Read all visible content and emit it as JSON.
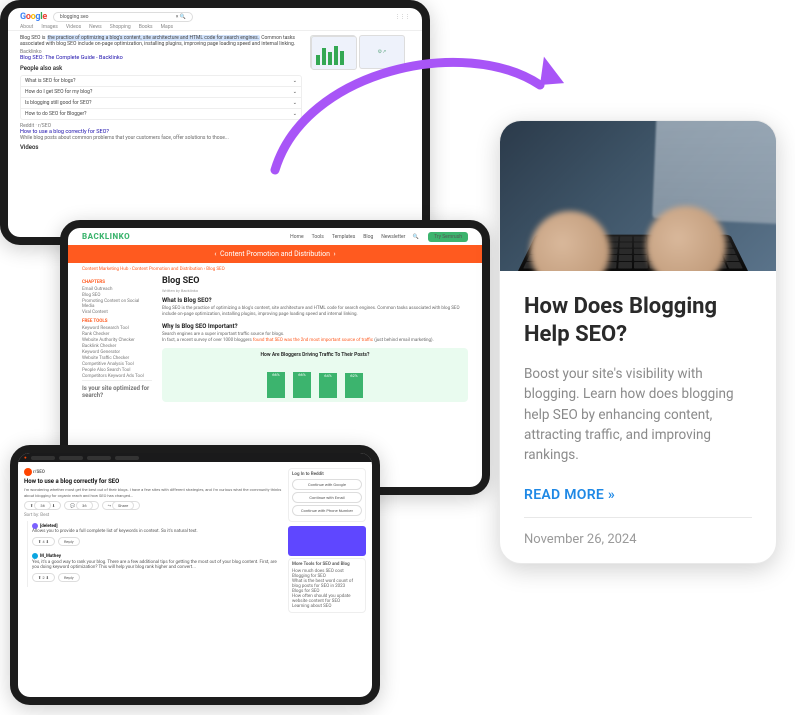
{
  "google": {
    "logo": [
      "G",
      "o",
      "o",
      "g",
      "l",
      "e"
    ],
    "query": "blogging seo",
    "tabs": [
      "About",
      "Images",
      "Videos",
      "News",
      "Shopping",
      "Books",
      "Maps"
    ],
    "snippet_lead": "Blog SEO is ",
    "snippet_hl": "the practice of optimizing a blog's content, site architecture and HTML code for search engines.",
    "snippet_tail": " Common tasks associated with blog SEO include on-page optimization, installing plugins, improving page loading speed and internal linking.",
    "source": "Backlinko",
    "source_title": "Blog SEO: The Complete Guide - Backlinko",
    "paa_title": "People also ask",
    "paa": [
      "What is SEO for blogs?",
      "How do I get SEO for my blog?",
      "Is blogging still good for SEO?",
      "How to do SEO for Blogger?"
    ],
    "reddit_src": "Reddit · r/SEO",
    "reddit_title": "How to use a blog correctly for SEO?",
    "reddit_sub": "While blog posts about common problems that your customers face, offer solutions to those...",
    "videos": "Videos"
  },
  "backlinko": {
    "brand": "BACKLINKO",
    "nav": [
      "Home",
      "Tools",
      "Templates",
      "Blog",
      "Newsletter"
    ],
    "cta_btn": "Try Semrush",
    "banner": "Content Promotion and Distribution",
    "crumb": "Content Marketing Hub  ›  Content Promotion and Distribution  ›  Blog SEO",
    "title": "Blog SEO",
    "byline": "Written by Backlinko",
    "h_what": "What Is Blog SEO?",
    "p_what": "Blog SEO is the practice of optimizing a blog's content, site architecture and HTML code for search engines. Common tasks associated with blog SEO include on-page optimization, installing plugins, improving page loading speed and internal linking.",
    "h_why": "Why Is Blog SEO Important?",
    "p_why": "Search engines are a super important traffic source for blogs.",
    "p_why2_a": "In fact, a recent survey of over 1000 bloggers ",
    "p_why2_link": "found that SEO was the 2nd most important source of traffic",
    "p_why2_b": " (just behind email marketing).",
    "chart_title": "How Are Bloggers Driving Traffic To Their Posts?",
    "side_chapters": "CHAPTERS",
    "side_ch": [
      "Email Outreach",
      "Blog SEO",
      "Promoting Content on Social Media",
      "Viral Content"
    ],
    "side_tools": "FREE TOOLS",
    "side_tl": [
      "Keyword Research Tool",
      "Rank Checker",
      "Website Authority Checker",
      "Backlink Checker",
      "Keyword Generator",
      "Website Traffic Checker",
      "Competitive Analysis Tool",
      "People Also Search Tool",
      "Competitors Keyword Ads Tool"
    ],
    "opt": "Is your site optimized for search?"
  },
  "chart_data": {
    "type": "bar",
    "title": "How Are Bloggers Driving Traffic To Their Posts?",
    "categories": [
      "",
      "",
      "",
      ""
    ],
    "values": [
      66,
      66,
      64,
      62
    ],
    "labels": [
      "66%",
      "66%",
      "64%",
      "62%"
    ],
    "ylim": [
      0,
      100
    ]
  },
  "reddit": {
    "community": "r/SEO",
    "title": "How to use a blog correctly for SEO",
    "body": "I'm wondering whether most get the best out of their blogs. I have a few sites with different strategies, and I'm curious what the community thinks about blogging for organic reach and how SEO has changed...",
    "vote": "36",
    "actions": [
      "36",
      "36",
      "Share"
    ],
    "best": "Sort by: Best",
    "login_title": "Log In to Reddit",
    "login_opts": [
      "Continue with Google",
      "Continue with Email",
      "Continue with Phone Number"
    ],
    "c1_user": "[deleted]",
    "c1_body": "Allows you to provide a full complete list of keywords in context. So it's natural text.",
    "c2_user": "M_Mathey",
    "c2_body": "Yes, it's a good way to rank your blog. There are a few additional tips for getting the most out of your blog content. First, are you doing keyword optimization? This will help your blog rank higher and convert...",
    "sb_h1": "More Tools for SEO and Blog",
    "sb_items": [
      "How much does SEO cost",
      "Blogging for SEO",
      "What is the best word count of blog posts for SEO in 2023",
      "Blogs for SEO",
      "How often should you update website content for SEO",
      "Learning about SEO"
    ]
  },
  "card": {
    "title": "How Does Blogging Help SEO?",
    "excerpt": "Boost your site's visibility with blogging. Learn how does blogging help SEO by enhancing content, attracting traffic, and improving rankings.",
    "more": "READ MORE »",
    "date": "November 26, 2024"
  }
}
